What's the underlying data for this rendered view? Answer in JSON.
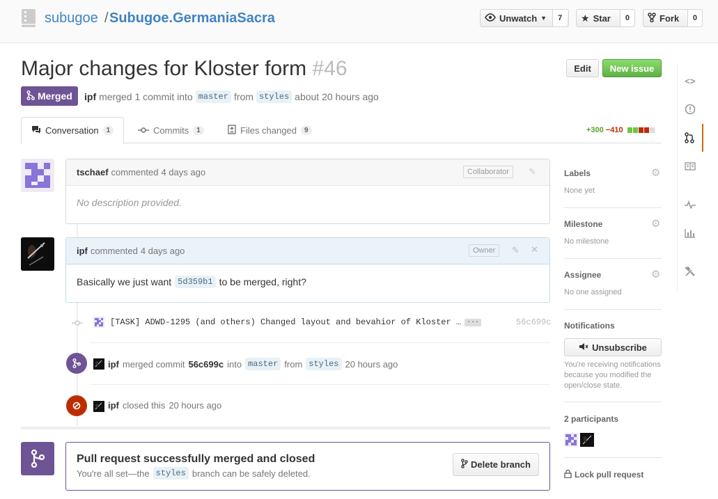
{
  "header": {
    "owner": "subugoe",
    "separator": "/",
    "repo": "Subugoe.GermaniaSacra",
    "watch": {
      "label": "Unwatch",
      "count": "7"
    },
    "star": {
      "label": "Star",
      "count": "0"
    },
    "fork": {
      "label": "Fork",
      "count": "0"
    }
  },
  "pr": {
    "title": "Major changes for Kloster form",
    "number": "#46",
    "edit_label": "Edit",
    "new_issue_label": "New issue",
    "state": "Merged",
    "author": "ipf",
    "merged_text": "merged 1 commit into",
    "base_branch": "master",
    "from_text": "from",
    "head_branch": "styles",
    "time": "about 20 hours ago"
  },
  "tabs": [
    {
      "label": "Conversation",
      "count": "1"
    },
    {
      "label": "Commits",
      "count": "1"
    },
    {
      "label": "Files changed",
      "count": "9"
    }
  ],
  "diffstat": {
    "additions": "+300",
    "deletions": "−410"
  },
  "comments": [
    {
      "author": "tschaef",
      "action": "commented",
      "time": "4 days ago",
      "role": "Collaborator",
      "body": "No description provided."
    },
    {
      "author": "ipf",
      "action": "commented",
      "time": "4 days ago",
      "role": "Owner",
      "body_before": "Basically we just want",
      "body_sha": "5d359b1",
      "body_after": "to be merged, right?"
    }
  ],
  "commit_event": {
    "message": "[TASK] ADWD-1295 (and others) Changed layout and bevahior of Kloster …",
    "ellipsis": "···",
    "sha": "56c699c"
  },
  "merge_event": {
    "author": "ipf",
    "text1": "merged commit",
    "sha": "56c699c",
    "text2": "into",
    "base": "master",
    "text3": "from",
    "head": "styles",
    "time": "20 hours ago"
  },
  "close_event": {
    "author": "ipf",
    "text": "closed this",
    "time": "20 hours ago"
  },
  "merge_box": {
    "title": "Pull request successfully merged and closed",
    "desc_before": "You're all set—the",
    "branch": "styles",
    "desc_after": "branch can be safely deleted.",
    "button": "Delete branch"
  },
  "sidebar": {
    "labels": {
      "title": "Labels",
      "value": "None yet"
    },
    "milestone": {
      "title": "Milestone",
      "value": "No milestone"
    },
    "assignee": {
      "title": "Assignee",
      "value": "No one assigned"
    },
    "notifications": {
      "title": "Notifications",
      "button": "Unsubscribe",
      "note": "You're receiving notifications because you modified the open/close state."
    },
    "participants": {
      "title": "2 participants"
    },
    "lock": "Lock pull request"
  },
  "colors": {
    "accent": "#4183c4",
    "merged": "#6e5494",
    "closed": "#bd2c00",
    "green": "#6cc644",
    "red": "#bd2c00"
  }
}
